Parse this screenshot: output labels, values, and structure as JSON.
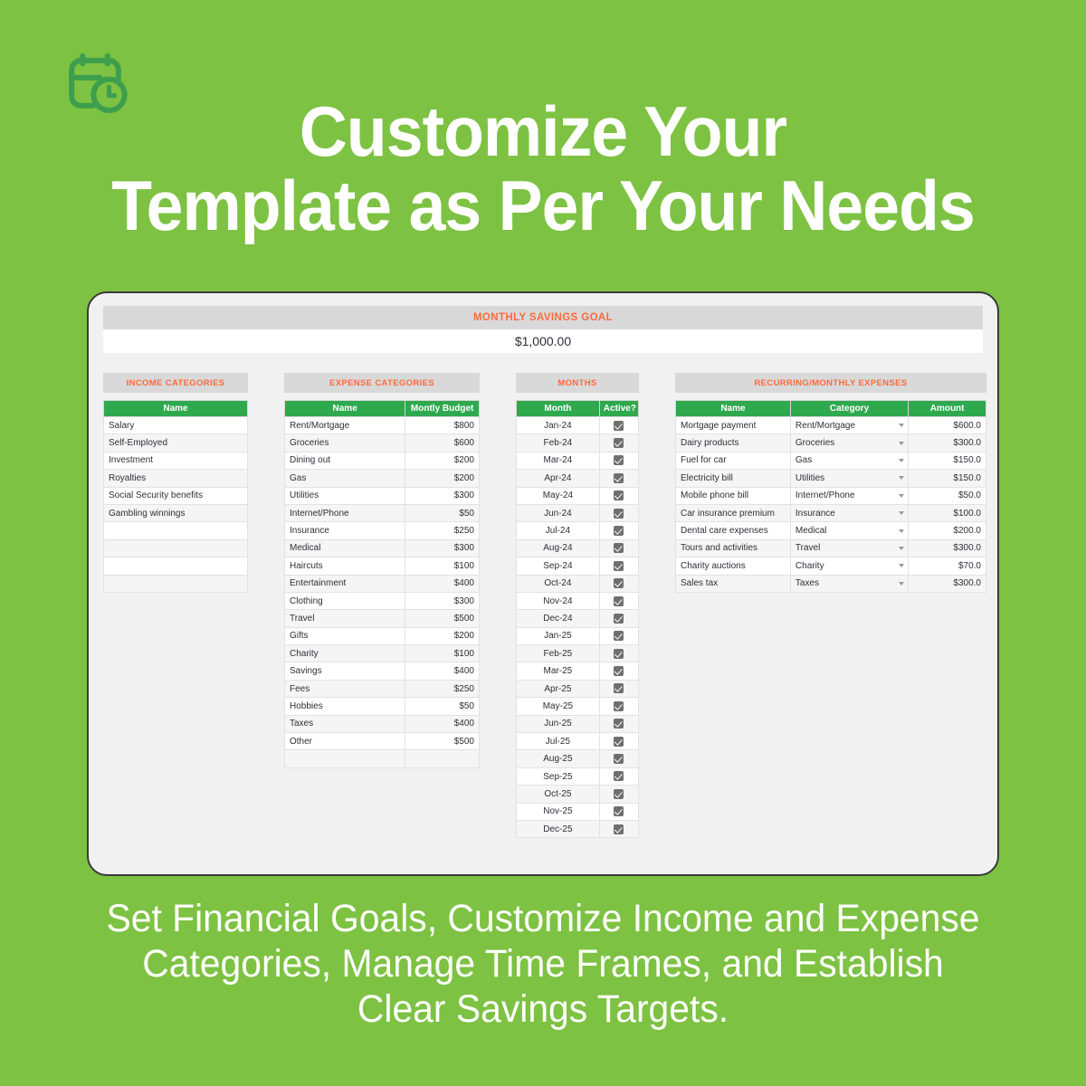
{
  "page": {
    "background_color": "#7dc242",
    "headline_line1": "Customize Your",
    "headline_line2": "Template as Per Your Needs",
    "caption_line1": "Set Financial Goals, Customize Income and Expense",
    "caption_line2": "Categories, Manage Time Frames, and Establish",
    "caption_line3": "Clear Savings Targets.",
    "logo_icon": "calendar-clock-icon",
    "logo_color": "#3d9e4d",
    "accent_color": "#fa6a3c",
    "header_green": "#2fa94e"
  },
  "savings_goal": {
    "title": "MONTHLY SAVINGS GOAL",
    "value": "$1,000.00"
  },
  "income": {
    "title": "INCOME CATEGORIES",
    "columns": [
      "Name"
    ],
    "rows": [
      "Salary",
      "Self-Employed",
      "Investment",
      "Royalties",
      "Social Security benefits",
      "Gambling winnings",
      "",
      "",
      "",
      ""
    ]
  },
  "expenses": {
    "title": "EXPENSE CATEGORIES",
    "columns": [
      "Name",
      "Montly Budget"
    ],
    "rows": [
      {
        "name": "Rent/Mortgage",
        "budget": "$800"
      },
      {
        "name": "Groceries",
        "budget": "$600"
      },
      {
        "name": "Dining out",
        "budget": "$200"
      },
      {
        "name": "Gas",
        "budget": "$200"
      },
      {
        "name": "Utilities",
        "budget": "$300"
      },
      {
        "name": "Internet/Phone",
        "budget": "$50"
      },
      {
        "name": "Insurance",
        "budget": "$250"
      },
      {
        "name": "Medical",
        "budget": "$300"
      },
      {
        "name": "Haircuts",
        "budget": "$100"
      },
      {
        "name": "Entertainment",
        "budget": "$400"
      },
      {
        "name": "Clothing",
        "budget": "$300"
      },
      {
        "name": "Travel",
        "budget": "$500"
      },
      {
        "name": "Gifts",
        "budget": "$200"
      },
      {
        "name": "Charity",
        "budget": "$100"
      },
      {
        "name": "Savings",
        "budget": "$400"
      },
      {
        "name": "Fees",
        "budget": "$250"
      },
      {
        "name": "Hobbies",
        "budget": "$50"
      },
      {
        "name": "Taxes",
        "budget": "$400"
      },
      {
        "name": "Other",
        "budget": "$500"
      },
      {
        "name": "",
        "budget": ""
      }
    ]
  },
  "months": {
    "title": "MONTHS",
    "columns": [
      "Month",
      "Active?"
    ],
    "rows": [
      {
        "month": "Jan-24",
        "active": true
      },
      {
        "month": "Feb-24",
        "active": true
      },
      {
        "month": "Mar-24",
        "active": true
      },
      {
        "month": "Apr-24",
        "active": true
      },
      {
        "month": "May-24",
        "active": true
      },
      {
        "month": "Jun-24",
        "active": true
      },
      {
        "month": "Jul-24",
        "active": true
      },
      {
        "month": "Aug-24",
        "active": true
      },
      {
        "month": "Sep-24",
        "active": true
      },
      {
        "month": "Oct-24",
        "active": true
      },
      {
        "month": "Nov-24",
        "active": true
      },
      {
        "month": "Dec-24",
        "active": true
      },
      {
        "month": "Jan-25",
        "active": true
      },
      {
        "month": "Feb-25",
        "active": true
      },
      {
        "month": "Mar-25",
        "active": true
      },
      {
        "month": "Apr-25",
        "active": true
      },
      {
        "month": "May-25",
        "active": true
      },
      {
        "month": "Jun-25",
        "active": true
      },
      {
        "month": "Jul-25",
        "active": true
      },
      {
        "month": "Aug-25",
        "active": true
      },
      {
        "month": "Sep-25",
        "active": true
      },
      {
        "month": "Oct-25",
        "active": true
      },
      {
        "month": "Nov-25",
        "active": true
      },
      {
        "month": "Dec-25",
        "active": true
      }
    ]
  },
  "recurring": {
    "title": "RECURRING/MONTHLY EXPENSES",
    "columns": [
      "Name",
      "Category",
      "Amount"
    ],
    "rows": [
      {
        "name": "Mortgage payment",
        "category": "Rent/Mortgage",
        "amount": "$600.0"
      },
      {
        "name": "Dairy products",
        "category": "Groceries",
        "amount": "$300.0"
      },
      {
        "name": "Fuel for car",
        "category": "Gas",
        "amount": "$150.0"
      },
      {
        "name": "Electricity bill",
        "category": "Utilities",
        "amount": "$150.0"
      },
      {
        "name": "Mobile phone bill",
        "category": "Internet/Phone",
        "amount": "$50.0"
      },
      {
        "name": "Car insurance premium",
        "category": "Insurance",
        "amount": "$100.0"
      },
      {
        "name": "Dental care expenses",
        "category": "Medical",
        "amount": "$200.0"
      },
      {
        "name": "Tours and activities",
        "category": "Travel",
        "amount": "$300.0"
      },
      {
        "name": "Charity auctions",
        "category": "Charity",
        "amount": "$70.0"
      },
      {
        "name": "Sales tax",
        "category": "Taxes",
        "amount": "$300.0"
      }
    ]
  }
}
